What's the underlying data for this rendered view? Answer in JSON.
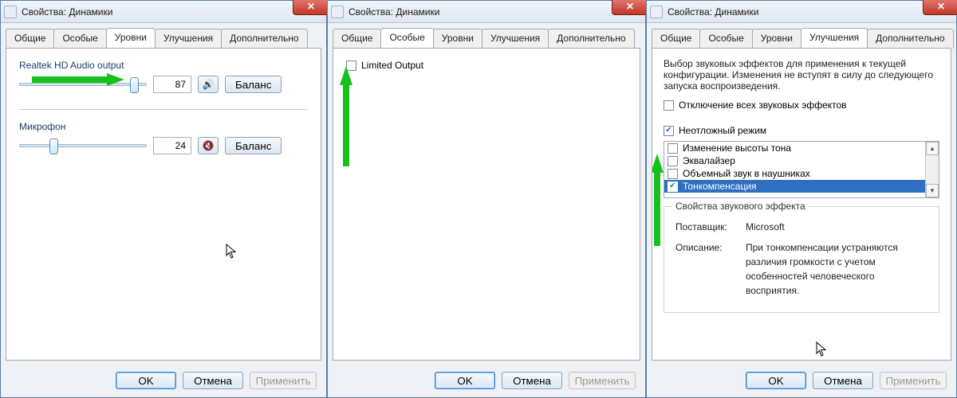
{
  "win1": {
    "title": "Свойства: Динамики",
    "tabs": [
      "Общие",
      "Особые",
      "Уровни",
      "Улучшения",
      "Дополнительно"
    ],
    "activeTab": 2,
    "device1": {
      "label": "Realtek HD Audio output",
      "value": "87",
      "balance": "Баланс",
      "muted": false
    },
    "device2": {
      "label": "Микрофон",
      "value": "24",
      "balance": "Баланс",
      "muted": true
    },
    "buttons": {
      "ok": "OK",
      "cancel": "Отмена",
      "apply": "Применить"
    }
  },
  "win2": {
    "title": "Свойства: Динамики",
    "tabs": [
      "Общие",
      "Особые",
      "Уровни",
      "Улучшения",
      "Дополнительно"
    ],
    "activeTab": 1,
    "limited": "Limited Output",
    "buttons": {
      "ok": "OK",
      "cancel": "Отмена",
      "apply": "Применить"
    }
  },
  "win3": {
    "title": "Свойства: Динамики",
    "tabs": [
      "Общие",
      "Особые",
      "Уровни",
      "Улучшения",
      "Дополнительно"
    ],
    "activeTab": 3,
    "description": "Выбор звуковых эффектов для применения к текущей конфигурации. Изменения не вступят в силу до следующего запуска воспроизведения.",
    "disableAll": "Отключение всех звуковых эффектов",
    "urgentMode": "Неотложный режим",
    "effects": [
      {
        "label": "Изменение высоты тона",
        "checked": false
      },
      {
        "label": "Эквалайзер",
        "checked": false
      },
      {
        "label": "Объемный звук в наушниках",
        "checked": false
      },
      {
        "label": "Тонкомпенсация",
        "checked": true,
        "selected": true
      }
    ],
    "propsLegend": "Свойства звукового эффекта",
    "vendorLabel": "Поставщик:",
    "vendorValue": "Microsoft",
    "descLabel": "Описание:",
    "descValue": "При тонкомпенсации устраняются различия громкости с учетом особенностей человеческого восприятия.",
    "buttons": {
      "ok": "OK",
      "cancel": "Отмена",
      "apply": "Применить"
    }
  }
}
